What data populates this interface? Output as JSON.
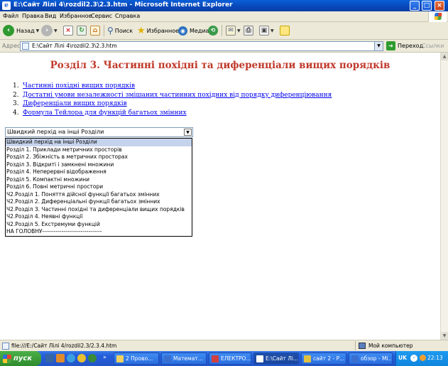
{
  "window": {
    "title": "E:\\Сайт Лілі 4\\rozdil2.3\\2.3.htm - Microsoft Internet Explorer"
  },
  "menu": [
    "Файл",
    "Правка",
    "Вид",
    "Избранное",
    "Сервис",
    "Справка"
  ],
  "toolbar": {
    "back": "Назад",
    "search": "Поиск",
    "favorites": "Избранное",
    "media": "Медиа"
  },
  "address": {
    "label": "Адрес:",
    "value": "E:\\Сайт Лілі 4\\rozdil2.3\\2.3.htm",
    "go": "Переход",
    "links": "Ссылки"
  },
  "page": {
    "heading": "Розділ 3. Частинні похідні та диференціали вищих порядків",
    "toc": [
      {
        "n": "1.",
        "text": "Частинні похідні вищих порядків"
      },
      {
        "n": "2.",
        "text": "Достатні умови незалежності змішаних частинних похідних від порядку диференціювання"
      },
      {
        "n": "3.",
        "text": "Диференціали вищих порядків"
      },
      {
        "n": "4.",
        "text": "Формула Тейлора для функцій багатьох змінних"
      }
    ],
    "select_value": "Швидкий перхід на інші Розділи",
    "options": [
      "Швидкий перхід на інші Розділи",
      "Розділ 1. Приклади метричних просторів",
      "Розділ 2. Збіжність в метричних просторах",
      "Розділ 3. Відкриті і замкнені множини",
      "Розділ 4. Неперервні відображення",
      "Розділ 5. Компактні множини",
      "Розділ 6. Повні метричні простори",
      "Ч2.Розділ 1. Поняття дійсної функції багатьох змінних",
      "Ч2.Розділ 2. Диференціальні функції багатьох змінних",
      "Ч2.Розділ 3. Частинні похідні та диференціали вищих порядків",
      "Ч2.Розділ 4. Неявні функції",
      "Ч2.Розділ 5. Екстремуми функцій",
      "НА ГОЛОВНУ-------------------------------"
    ]
  },
  "status": {
    "text": "file:///E:/Сайт Лілі 4/rozdil2.3/2.3.4.htm",
    "zone": "Мой компьютер"
  },
  "taskbar": {
    "start": "пуск",
    "buttons": [
      "2 Прово...",
      "Математ...",
      "ЕЛЕКТРО...",
      "E:\\Сайт Лі...",
      "сайт 2 - Р...",
      "обзор - Mi..."
    ],
    "lang": "UK",
    "clock": "22:13"
  }
}
